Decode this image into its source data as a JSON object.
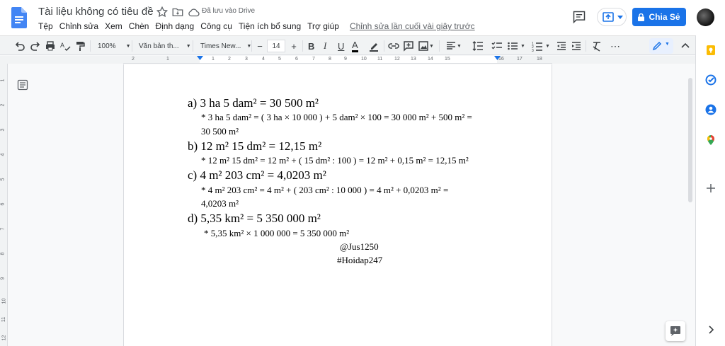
{
  "header": {
    "title": "Tài liệu không có tiêu đề",
    "saved_status": "Đã lưu vào Drive",
    "share_label": "Chia Sẻ"
  },
  "menu": {
    "items": [
      "Tệp",
      "Chỉnh sửa",
      "Xem",
      "Chèn",
      "Định dạng",
      "Công cụ",
      "Tiện ích bổ sung",
      "Trợ giúp"
    ],
    "last_edit": "Chỉnh sửa lần cuối vài giây trước"
  },
  "toolbar": {
    "zoom": "100%",
    "style": "Văn bản th...",
    "font": "Times New...",
    "font_size": "14",
    "minus": "−",
    "plus": "+",
    "bold": "B",
    "italic": "I",
    "underline": "U",
    "text_color": "A",
    "more": "⋯"
  },
  "ruler": {
    "labels": [
      "2",
      "1",
      "1",
      "2",
      "3",
      "4",
      "5",
      "6",
      "7",
      "8",
      "9",
      "10",
      "11",
      "12",
      "13",
      "14",
      "15",
      "16",
      "17",
      "18"
    ],
    "vertical_labels": [
      "1",
      "2",
      "3",
      "4",
      "5",
      "6",
      "7",
      "8",
      "9",
      "10",
      "11",
      "12"
    ]
  },
  "document": {
    "lines": [
      {
        "text": "a) 3 ha 5 dam² = 30 500 m²",
        "size": "big"
      },
      {
        "text": "* 3 ha 5 dam² = ( 3 ha × 10 000 ) + 5 dam² × 100 = 30 000 m² + 500 m² =",
        "size": "small"
      },
      {
        "text": "30 500 m²",
        "size": "small"
      },
      {
        "text": "b) 12 m² 15 dm² = 12,15 m²",
        "size": "big"
      },
      {
        "text": "* 12 m² 15 dm² = 12 m² + ( 15 dm² : 100 ) = 12 m² + 0,15 m² = 12,15 m²",
        "size": "small"
      },
      {
        "text": "c) 4 m² 203 cm² = 4,0203 m²",
        "size": "big"
      },
      {
        "text": "* 4 m² 203 cm² = 4 m² + ( 203 cm² : 10 000 ) = 4 m² + 0,0203 m² =",
        "size": "small"
      },
      {
        "text": "4,0203 m²",
        "size": "small"
      },
      {
        "text": "d) 5,35 km² = 5 350 000 m²",
        "size": "big"
      },
      {
        "text": "* 5,35 km² × 1 000 000 = 5 350 000 m²",
        "size": "small"
      },
      {
        "text": "@Jus1250",
        "size": "small"
      },
      {
        "text": "#Hoidap247",
        "size": "small"
      }
    ]
  },
  "colors": {
    "accent": "#1a73e8",
    "doc_icon": "#4285f4"
  }
}
